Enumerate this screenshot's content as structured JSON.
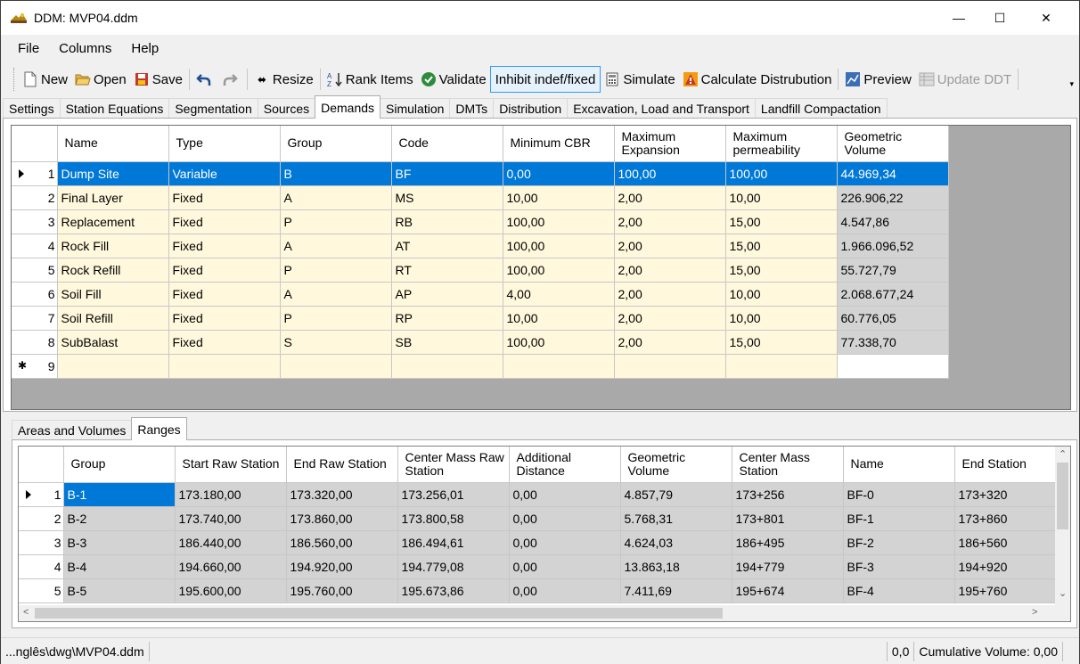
{
  "window": {
    "title": "DDM: MVP04.ddm",
    "min": "—",
    "max": "☐",
    "close": "✕"
  },
  "menu": [
    "File",
    "Columns",
    "Help"
  ],
  "toolbar": {
    "new": "New",
    "open": "Open",
    "save": "Save",
    "resize": "Resize",
    "rank_items": "Rank Items",
    "validate": "Validate",
    "inhibit": "Inhibit indef/fixed",
    "simulate": "Simulate",
    "calculate": "Calculate Distrubution",
    "preview": "Preview",
    "update_ddt": "Update DDT"
  },
  "main_tabs": [
    "Settings",
    "Station Equations",
    "Segmentation",
    "Sources",
    "Demands",
    "Simulation",
    "DMTs",
    "Distribution",
    "Excavation, Load and Transport",
    "Landfill Compactation"
  ],
  "demands": {
    "headers": [
      "Name",
      "Type",
      "Group",
      "Code",
      "Minimum CBR",
      "Maximum Expansion",
      "Maximum permeability",
      "Geometric Volume"
    ],
    "rows": [
      [
        "1",
        "Dump Site",
        "Variable",
        "B",
        "BF",
        "0,00",
        "100,00",
        "100,00",
        "44.969,34"
      ],
      [
        "2",
        "Final Layer",
        "Fixed",
        "A",
        "MS",
        "10,00",
        "2,00",
        "10,00",
        "226.906,22"
      ],
      [
        "3",
        "Replacement",
        "Fixed",
        "P",
        "RB",
        "100,00",
        "2,00",
        "15,00",
        "4.547,86"
      ],
      [
        "4",
        "Rock Fill",
        "Fixed",
        "A",
        "AT",
        "100,00",
        "2,00",
        "15,00",
        "1.966.096,52"
      ],
      [
        "5",
        "Rock Refill",
        "Fixed",
        "P",
        "RT",
        "100,00",
        "2,00",
        "15,00",
        "55.727,79"
      ],
      [
        "6",
        "Soil Fill",
        "Fixed",
        "A",
        "AP",
        "4,00",
        "2,00",
        "10,00",
        "2.068.677,24"
      ],
      [
        "7",
        "Soil Refill",
        "Fixed",
        "P",
        "RP",
        "10,00",
        "2,00",
        "10,00",
        "60.776,05"
      ],
      [
        "8",
        "SubBalast",
        "Fixed",
        "S",
        "SB",
        "100,00",
        "2,00",
        "15,00",
        "77.338,70"
      ]
    ],
    "new_row": {
      "num": "9",
      "marker": "✱"
    }
  },
  "sub_tabs": [
    "Areas and Volumes",
    "Ranges"
  ],
  "ranges": {
    "headers": [
      "Group",
      "Start Raw Station",
      "End Raw Station",
      "Center Mass Raw Station",
      "Additional Distance",
      "Geometric Volume",
      "Center Mass Station",
      "Name",
      "End Station"
    ],
    "rows": [
      [
        "1",
        "B-1",
        "173.180,00",
        "173.320,00",
        "173.256,01",
        "0,00",
        "4.857,79",
        "173+256",
        "BF-0",
        "173+320"
      ],
      [
        "2",
        "B-2",
        "173.740,00",
        "173.860,00",
        "173.800,58",
        "0,00",
        "5.768,31",
        "173+801",
        "BF-1",
        "173+860"
      ],
      [
        "3",
        "B-3",
        "186.440,00",
        "186.560,00",
        "186.494,61",
        "0,00",
        "4.624,03",
        "186+495",
        "BF-2",
        "186+560"
      ],
      [
        "4",
        "B-4",
        "194.660,00",
        "194.920,00",
        "194.779,08",
        "0,00",
        "13.863,18",
        "194+779",
        "BF-3",
        "194+920"
      ],
      [
        "5",
        "B-5",
        "195.600,00",
        "195.760,00",
        "195.673,86",
        "0,00",
        "7.411,69",
        "195+674",
        "BF-4",
        "195+760"
      ]
    ]
  },
  "status": {
    "path": "...nglês\\dwg\\MVP04.ddm",
    "value": "0,0",
    "cumulative": "Cumulative Volume: 0,00"
  }
}
